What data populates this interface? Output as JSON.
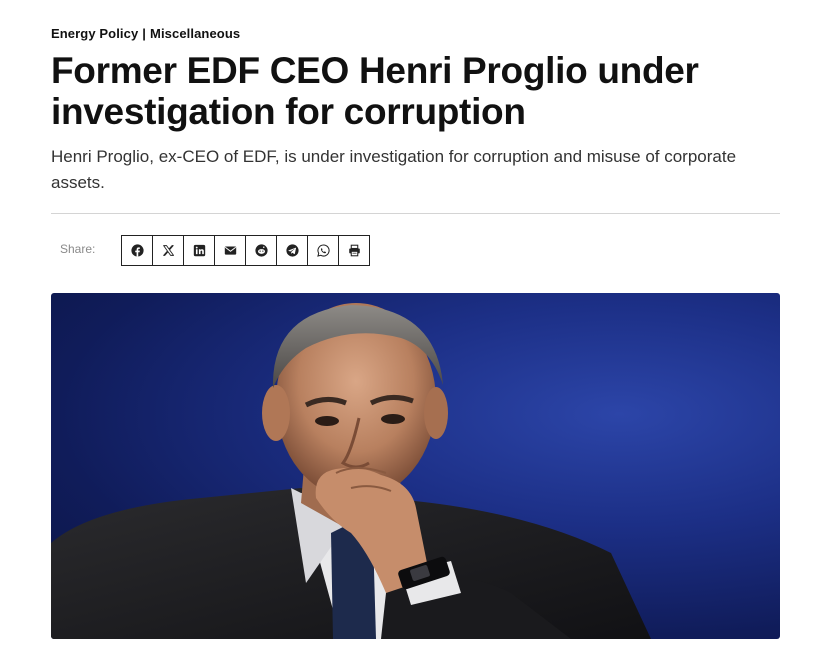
{
  "article": {
    "categories": [
      "Energy Policy",
      "Miscellaneous"
    ],
    "category_separator": "|",
    "title": "Former EDF CEO Henri Proglio under investigation for corruption",
    "subtitle": "Henri Proglio, ex-CEO of EDF, is under investigation for corruption and misuse of corporate assets."
  },
  "share": {
    "label": "Share:",
    "buttons": [
      "facebook-icon",
      "x-icon",
      "linkedin-icon",
      "email-icon",
      "reddit-icon",
      "telegram-icon",
      "whatsapp-icon",
      "print-icon"
    ]
  },
  "colors": {
    "text": "#111111",
    "subtitle": "#333333",
    "divider": "#d4d4d4",
    "hero_background": "#1c2f86"
  }
}
